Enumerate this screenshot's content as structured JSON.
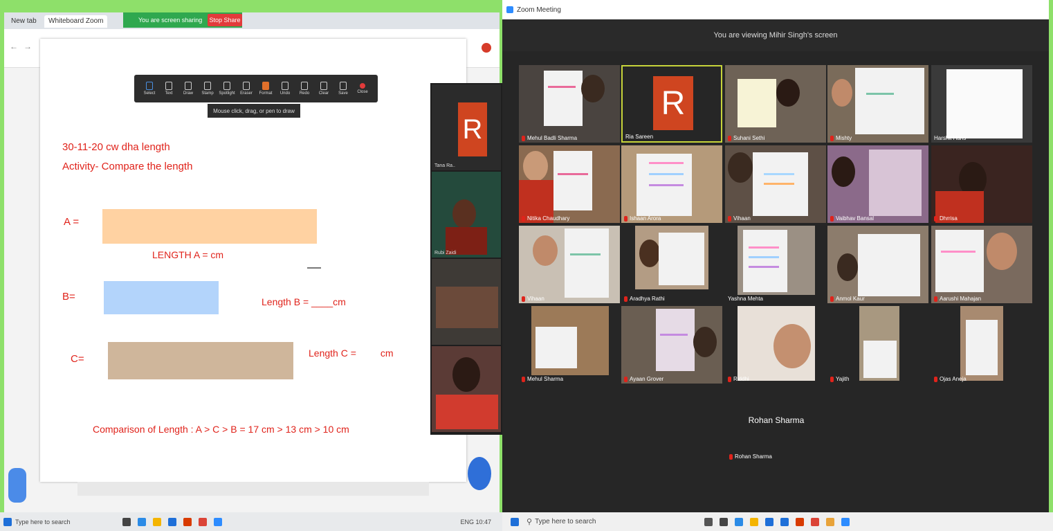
{
  "left": {
    "tabs": [
      "New tab",
      "Whiteboard Zoom"
    ],
    "share_banner": "You are screen sharing",
    "stop_share": "Stop Share",
    "toolbar": [
      "Select",
      "Text",
      "Draw",
      "Stamp",
      "Spotlight",
      "Eraser",
      "Format",
      "Undo",
      "Redo",
      "Clear",
      "Save",
      "Close"
    ],
    "tooltip": "Mouse click, drag, or pen to draw",
    "whiteboard": {
      "line1": "30-11-20   cw   dha length",
      "line2": "Activity- Compare the length",
      "label_a": "A =",
      "length_a": "LENGTH A =       cm",
      "label_b": "B=",
      "length_b": "Length B = ____cm",
      "label_c": "C=",
      "length_c": "Length C =         cm",
      "comparison": "Comparison of Length : A > C > B  =  17 cm > 13 cm > 10 cm",
      "colors": {
        "bar_a": "#ffd2a2",
        "bar_b": "#b3d4fb",
        "bar_c": "#cfb69b",
        "ink": "#e0231b"
      }
    },
    "panel_names": [
      "Tana Ra..",
      "Rubi Zaidi",
      "",
      ""
    ],
    "taskbar_search": "Type here to search",
    "taskbar_time": "ENG  10:47"
  },
  "right": {
    "title": "Zoom Meeting",
    "top_label": "You are viewing Mihir Singh's screen",
    "tiles": [
      {
        "name": "Mehul Badli Sharma"
      },
      {
        "name": "Ria Sareen"
      },
      {
        "name": "Suhani Sethi"
      },
      {
        "name": "Mishty"
      },
      {
        "name": "Harshit Hans"
      },
      {
        "name": "Nitika Chaudhary"
      },
      {
        "name": "Ishaan Arora"
      },
      {
        "name": "Vihaan"
      },
      {
        "name": "Vaibhav Bansal"
      },
      {
        "name": "Dhrrisa"
      },
      {
        "name": "Vihaan"
      },
      {
        "name": "Aradhya Rathi"
      },
      {
        "name": "Yashna Mehta"
      },
      {
        "name": "Anmol Kaur"
      },
      {
        "name": "Aarushi Mahajan"
      },
      {
        "name": "Mehul Sharma"
      },
      {
        "name": "Ayaan Grover"
      },
      {
        "name": "Riddhi"
      },
      {
        "name": "Yajith"
      },
      {
        "name": "Ojas Aneja"
      }
    ],
    "extra_tile": {
      "label": "Rohan Sharma",
      "name": "Rohan Sharma"
    },
    "taskbar_search": "Type here to search"
  },
  "avatar_letter": "R",
  "avatar_color": "#cf4520"
}
